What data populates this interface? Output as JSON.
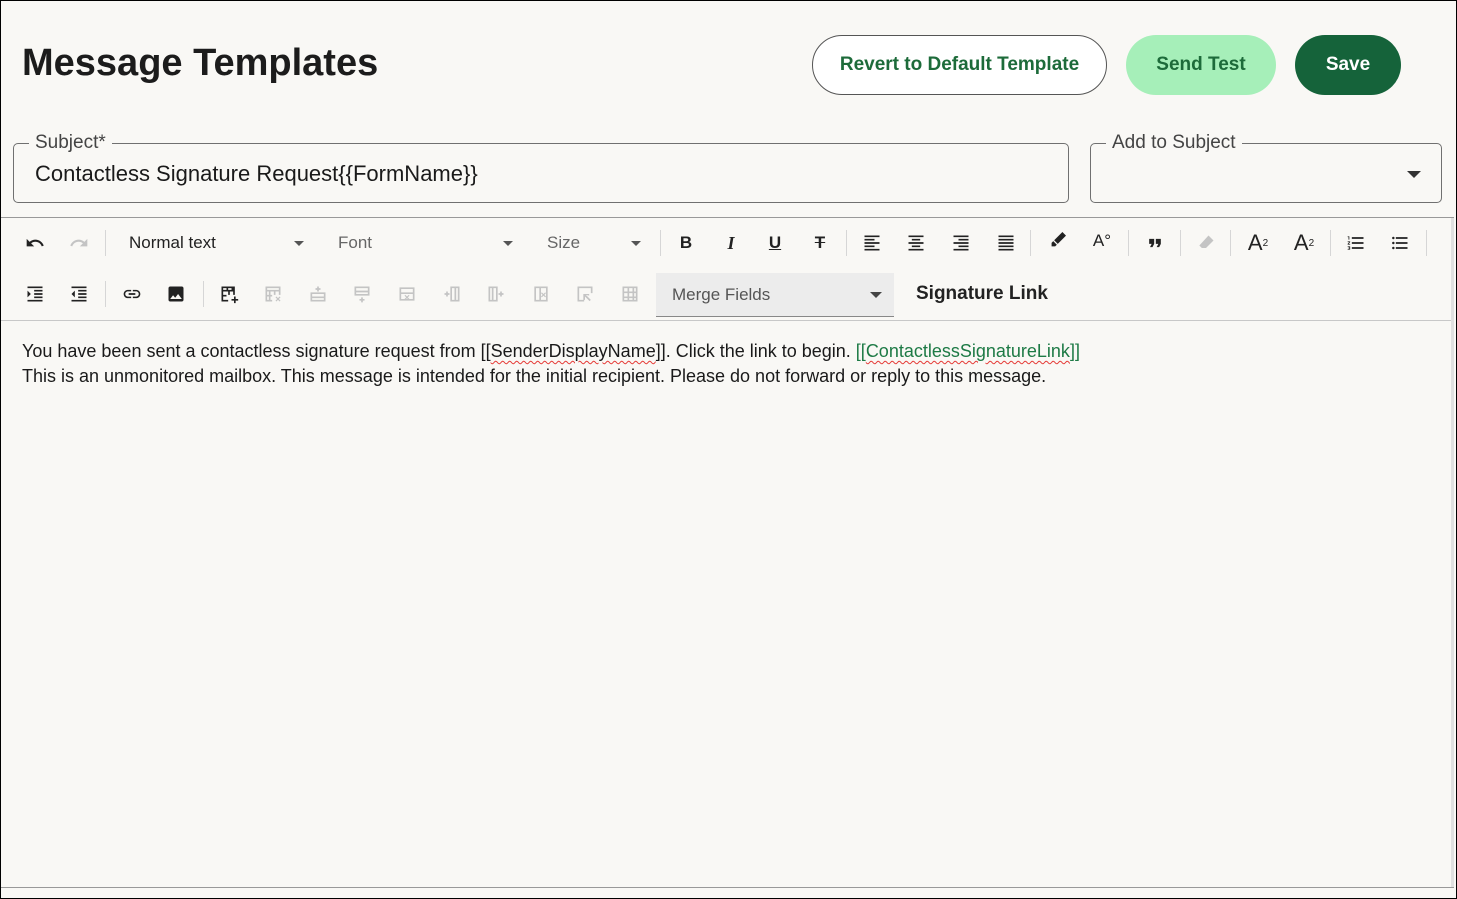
{
  "page": {
    "title": "Message Templates"
  },
  "actions": {
    "revert_label": "Revert to Default Template",
    "send_test_label": "Send Test",
    "save_label": "Save"
  },
  "subject": {
    "label": "Subject*",
    "value": "Contactless Signature Request{{FormName}}"
  },
  "add_to_subject": {
    "label": "Add to Subject",
    "value": ""
  },
  "toolbar": {
    "block_format": "Normal text",
    "font": "Font",
    "size": "Size",
    "merge_fields": "Merge Fields",
    "signature_link": "Signature Link",
    "icons": [
      "undo-icon",
      "redo-icon",
      "bold-icon",
      "italic-icon",
      "underline-icon",
      "strikethrough-icon",
      "align-left-icon",
      "align-center-icon",
      "align-right-icon",
      "align-justify-icon",
      "highlight-icon",
      "text-color-icon",
      "blockquote-icon",
      "clear-format-icon",
      "superscript-icon",
      "subscript-icon",
      "ordered-list-icon",
      "bullet-list-icon",
      "indent-icon",
      "outdent-icon",
      "link-icon",
      "image-icon",
      "insert-table-icon"
    ]
  },
  "editor": {
    "line1_pre": "You have been sent a contactless signature request from [[",
    "line1_field": "SenderDisplayName",
    "line1_mid": "]]. Click the link to begin. ",
    "line1_link_open": "[[",
    "line1_link_field": "ContactlessSignatureLink",
    "line1_link_close": "]]",
    "line2": "This is an unmonitored mailbox. This message is intended for the initial recipient. Please do not forward or reply to this message."
  },
  "colors": {
    "accent": "#15633a",
    "accent_light": "#a6efb9",
    "link": "#1d7a45"
  }
}
